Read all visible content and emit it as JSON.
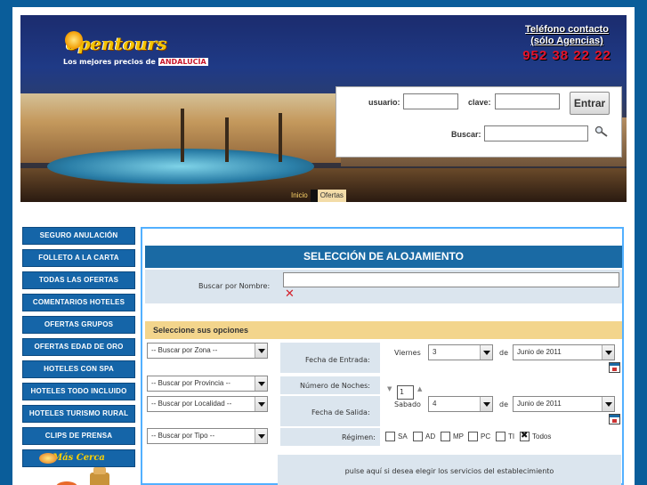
{
  "header": {
    "logo": {
      "name": "opentours",
      "tagline_prefix": "Los mejores precios de",
      "tagline_region": "ANDALUCÍA"
    },
    "phone": {
      "line1": "Teléfono contacto",
      "line2": "(sólo Agencias)",
      "number": "952 38 22 22"
    },
    "login": {
      "user_label": "usuario:",
      "user_value": "",
      "password_label": "clave:",
      "password_value": "",
      "submit_label": "Entrar"
    },
    "search": {
      "label": "Buscar:",
      "value": "",
      "icon": "magnifier-icon"
    },
    "tabs": [
      {
        "label": "Inicio"
      },
      {
        "label": "Ofertas"
      }
    ]
  },
  "sidebar": {
    "items": [
      {
        "label": "SEGURO ANULACIÓN"
      },
      {
        "label": "FOLLETO A LA CARTA"
      },
      {
        "label": "TODAS LAS OFERTAS"
      },
      {
        "label": "COMENTARIOS HOTELES"
      },
      {
        "label": "OFERTAS GRUPOS"
      },
      {
        "label": "OFERTAS EDAD DE ORO"
      },
      {
        "label": "HOTELES CON SPA"
      },
      {
        "label": "HOTELES TODO INCLUIDO"
      },
      {
        "label": "HOTELES TURISMO RURAL"
      },
      {
        "label": "CLIPS DE PRENSA"
      }
    ],
    "banner": {
      "label": "Más Cerca"
    }
  },
  "main": {
    "title": "SELECCIÓN DE ALOJAMIENTO",
    "name_search": {
      "label": "Buscar por Nombre:",
      "value": "",
      "clear_icon": "clear-x-icon"
    },
    "options_title": "Seleccione sus opciones",
    "filters": {
      "zona": "-- Buscar por Zona --",
      "provincia": "-- Buscar por Provincia --",
      "localidad": "-- Buscar por Localidad --",
      "tipo": "-- Buscar por Tipo --"
    },
    "checkin": {
      "label": "Fecha de Entrada:",
      "weekday": "Viernes",
      "day": "3",
      "of": "de",
      "month": "Junio de 2011"
    },
    "nights": {
      "label": "Número de Noches:",
      "value": "1"
    },
    "checkout": {
      "label": "Fecha de Salida:",
      "weekday": "Sabado",
      "day": "4",
      "of": "de",
      "month": "Junio de 2011"
    },
    "regimen": {
      "label": "Régimen:",
      "options": [
        {
          "label": "SA",
          "checked": false
        },
        {
          "label": "AD",
          "checked": false
        },
        {
          "label": "MP",
          "checked": false
        },
        {
          "label": "PC",
          "checked": false
        },
        {
          "label": "TI",
          "checked": false
        },
        {
          "label": "Todos",
          "checked": true
        }
      ]
    },
    "services_link": "pulse aquí si desea elegir los servicios del establecimiento"
  },
  "colors": {
    "page_bg": "#0a5d9a",
    "nav_blue": "#1565a8",
    "title_bar": "#1a6aa4",
    "options_bar": "#f3d58c",
    "cell_bg": "#dbe5ee",
    "phone_red": "#e4142c"
  }
}
